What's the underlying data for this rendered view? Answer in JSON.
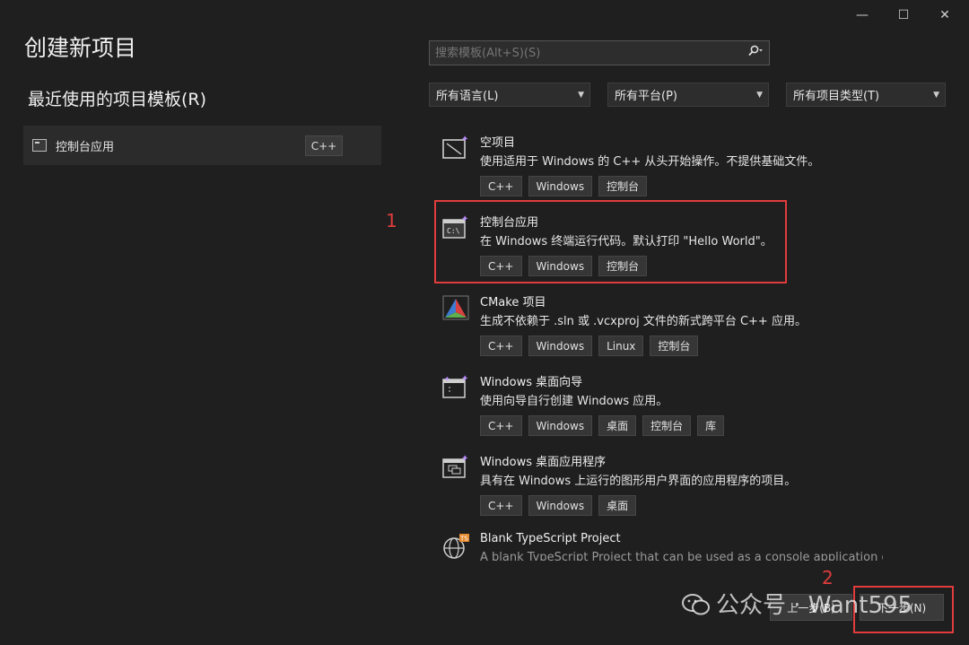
{
  "window": {
    "minimize": "—",
    "maximize": "☐",
    "close": "✕"
  },
  "title": "创建新项目",
  "recent": {
    "heading": "最近使用的项目模板(R)",
    "items": [
      {
        "name": "控制台应用",
        "lang": "C++"
      }
    ]
  },
  "search": {
    "placeholder": "搜索模板(Alt+S)(S)"
  },
  "filters": {
    "language": "所有语言(L)",
    "platform": "所有平台(P)",
    "project_type": "所有项目类型(T)"
  },
  "templates": [
    {
      "name": "空项目",
      "desc": "使用适用于 Windows 的 C++ 从头开始操作。不提供基础文件。",
      "tags": [
        "C++",
        "Windows",
        "控制台"
      ],
      "icon": "empty-project-icon"
    },
    {
      "name": "控制台应用",
      "desc": "在 Windows 终端运行代码。默认打印 \"Hello World\"。",
      "tags": [
        "C++",
        "Windows",
        "控制台"
      ],
      "icon": "console-app-icon"
    },
    {
      "name": "CMake 项目",
      "desc": "生成不依赖于 .sln 或 .vcxproj 文件的新式跨平台 C++ 应用。",
      "tags": [
        "C++",
        "Windows",
        "Linux",
        "控制台"
      ],
      "icon": "cmake-icon"
    },
    {
      "name": "Windows 桌面向导",
      "desc": "使用向导自行创建 Windows 应用。",
      "tags": [
        "C++",
        "Windows",
        "桌面",
        "控制台",
        "库"
      ],
      "icon": "desktop-wizard-icon"
    },
    {
      "name": "Windows 桌面应用程序",
      "desc": "具有在 Windows 上运行的图形用户界面的应用程序的项目。",
      "tags": [
        "C++",
        "Windows",
        "桌面"
      ],
      "icon": "desktop-app-icon"
    },
    {
      "name": "Blank TypeScript Project",
      "desc": "A blank TypeScript Project that can be used as a console application or",
      "tags": [],
      "icon": "typescript-icon"
    }
  ],
  "annotations": {
    "marker1": "1",
    "marker2": "2"
  },
  "footer": {
    "back": "上一步(B)",
    "next": "下一步(N)"
  },
  "watermark": "公众号 · Want595",
  "colors": {
    "accent_red": "#e03c3c",
    "background": "#1f1f1f"
  }
}
